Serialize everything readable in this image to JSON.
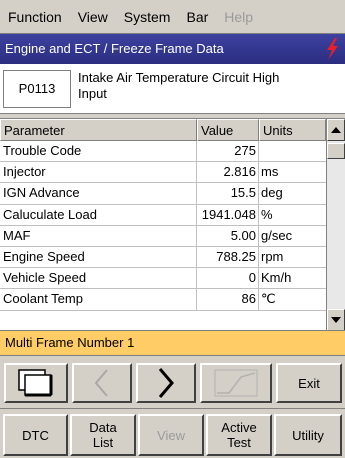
{
  "menu": {
    "items": [
      {
        "label": "Function"
      },
      {
        "label": "View"
      },
      {
        "label": "System"
      },
      {
        "label": "Bar"
      },
      {
        "label": "Help"
      }
    ]
  },
  "title": "Engine and ECT / Freeze Frame Data",
  "dtc": {
    "code": "P0113",
    "description_line1": "Intake Air Temperature Circuit High",
    "description_line2": "Input"
  },
  "table": {
    "headers": {
      "parameter": "Parameter",
      "value": "Value",
      "units": "Units"
    },
    "rows": [
      {
        "parameter": "Trouble Code",
        "value": "275",
        "units": ""
      },
      {
        "parameter": "Injector",
        "value": "2.816",
        "units": "ms"
      },
      {
        "parameter": "IGN Advance",
        "value": "15.5",
        "units": "deg"
      },
      {
        "parameter": "Caluculate Load",
        "value": "1941.048",
        "units": "%"
      },
      {
        "parameter": "MAF",
        "value": "5.00",
        "units": "g/sec"
      },
      {
        "parameter": "Engine Speed",
        "value": "788.25",
        "units": "rpm"
      },
      {
        "parameter": "Vehicle Speed",
        "value": "0",
        "units": "Km/h"
      },
      {
        "parameter": "Coolant Temp",
        "value": "86",
        "units": "℃"
      }
    ]
  },
  "frame_label": "Multi Frame Number 1",
  "toolbar": {
    "exit_label": "Exit"
  },
  "tabs": {
    "dtc": "DTC",
    "data_list_1": "Data",
    "data_list_2": "List",
    "view": "View",
    "active_test_1": "Active",
    "active_test_2": "Test",
    "utility": "Utility"
  },
  "colors": {
    "title_bg": "#2f3390",
    "frame_bar": "#ffcc66",
    "bolt": "#e8202a"
  }
}
